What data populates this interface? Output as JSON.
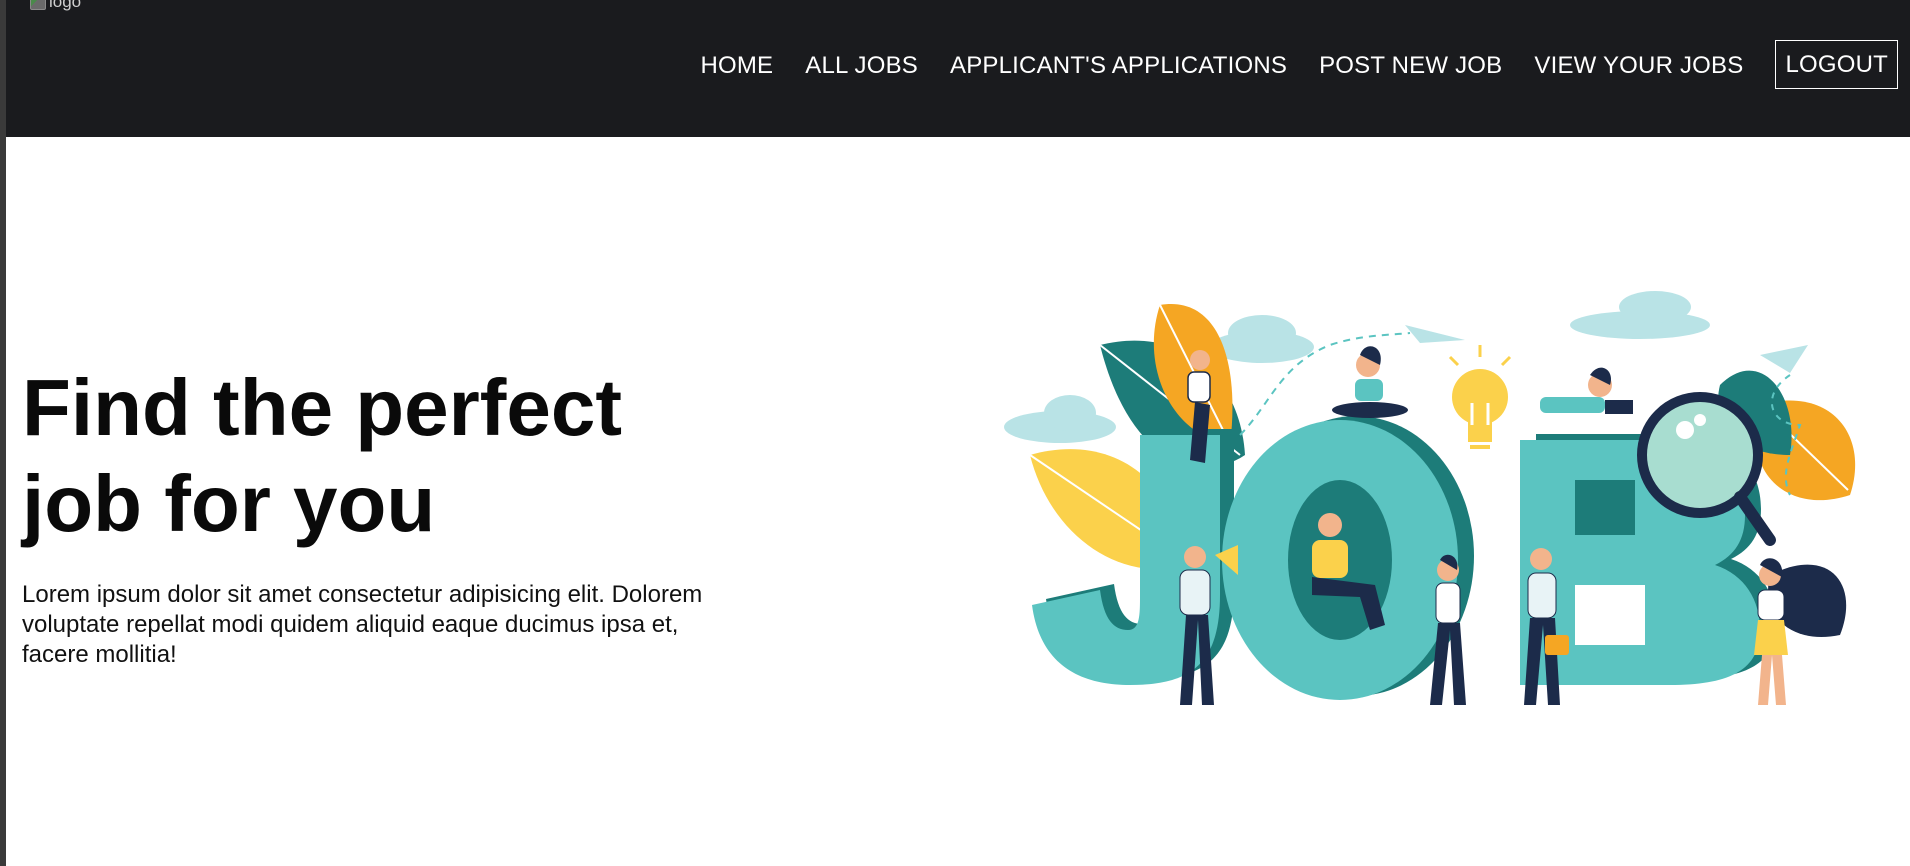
{
  "header": {
    "logo_alt": "logo",
    "nav": [
      "HOME",
      "ALL JOBS",
      "APPLICANT'S APPLICATIONS",
      "POST NEW JOB",
      "VIEW YOUR JOBS"
    ],
    "logout": "LOGOUT"
  },
  "hero": {
    "title_line1": "Find the perfect",
    "title_line2": "job for you",
    "description_line1": "Lorem ipsum dolor sit amet consectetur adipisicing elit. Dolorem",
    "description_line2": "voluptate repellat modi quidem aliquid eaque ducimus ipsa et,",
    "description_line3": "facere mollitia!",
    "illustration_text": "JOB"
  },
  "colors": {
    "navbar": "#1a1b1e",
    "teal": "#5bc4c1",
    "dark_teal": "#1d7c79",
    "orange": "#f5a623",
    "yellow": "#fbd14b",
    "navy": "#1c2b4a"
  }
}
